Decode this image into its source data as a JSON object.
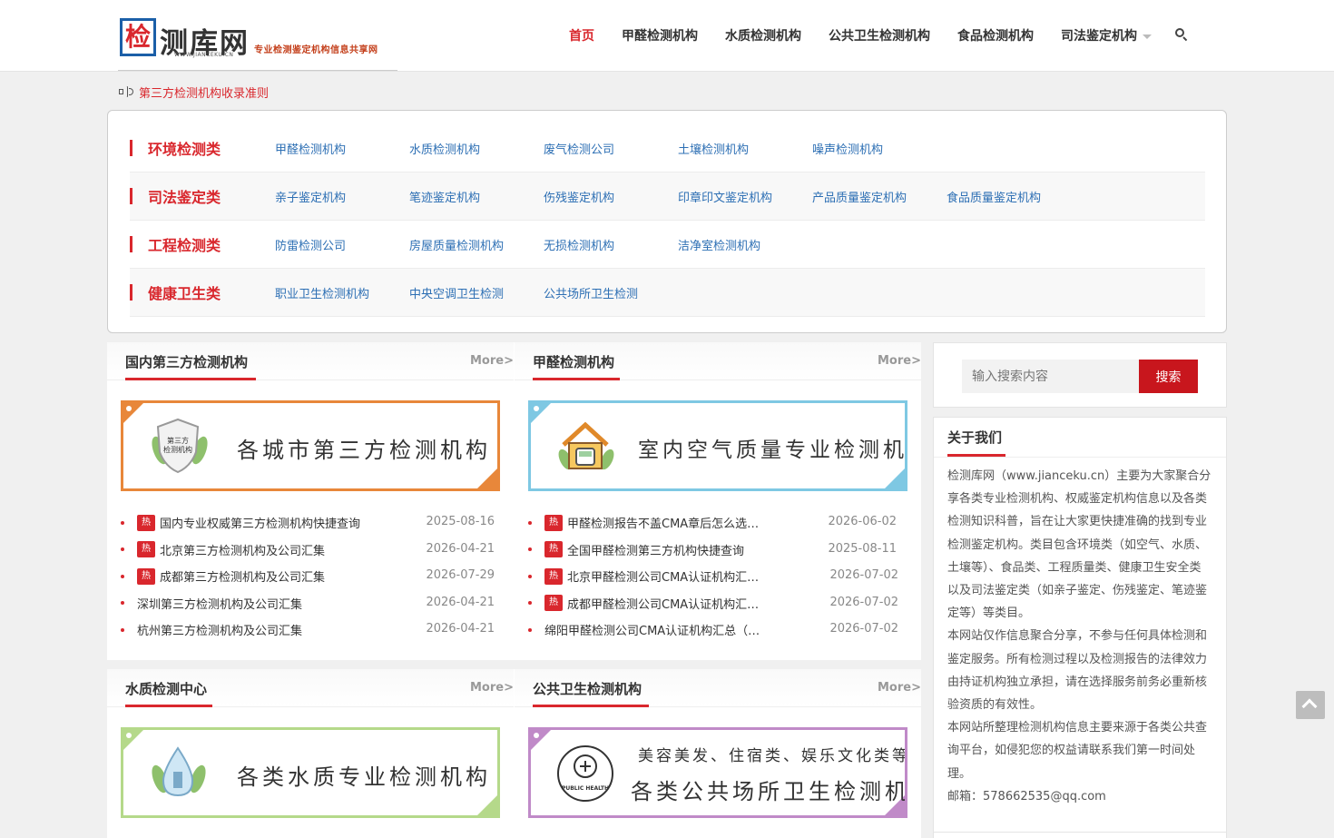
{
  "header": {
    "logo_char": "检",
    "logo_text": "测库网",
    "logo_url": "WWW.JIANCEKU.CN",
    "logo_slogan": "专业检测鉴定机构信息共享网",
    "nav": [
      {
        "label": "首页"
      },
      {
        "label": "甲醛检测机构"
      },
      {
        "label": "水质检测机构"
      },
      {
        "label": "公共卫生检测机构"
      },
      {
        "label": "食品检测机构"
      },
      {
        "label": "司法鉴定机构"
      }
    ]
  },
  "notice": {
    "text": "第三方检测机构收录准则"
  },
  "categories": [
    {
      "title": "环境检测类",
      "links": [
        "甲醛检测机构",
        "水质检测机构",
        "废气检测公司",
        "土壤检测机构",
        "噪声检测机构"
      ]
    },
    {
      "title": "司法鉴定类",
      "links": [
        "亲子鉴定机构",
        "笔迹鉴定机构",
        "伤残鉴定机构",
        "印章印文鉴定机构",
        "产品质量鉴定机构",
        "食品质量鉴定机构"
      ]
    },
    {
      "title": "工程检测类",
      "links": [
        "防雷检测公司",
        "房屋质量检测机构",
        "无损检测机构",
        "洁净室检测机构"
      ]
    },
    {
      "title": "健康卫生类",
      "links": [
        "职业卫生检测机构",
        "中央空调卫生检测",
        "公共场所卫生检测"
      ]
    }
  ],
  "panels": [
    {
      "title": "国内第三方检测机构",
      "more": "More>",
      "banner_text": "各城市第三方检测机构",
      "banner_icon_text": "第三方\n检测机构",
      "accent": "#e8873a",
      "items": [
        {
          "hot": true,
          "title": "国内专业权威第三方检测机构快捷查询",
          "date": "2025-08-16"
        },
        {
          "hot": true,
          "title": "北京第三方检测机构及公司汇集",
          "date": "2026-04-21"
        },
        {
          "hot": true,
          "title": "成都第三方检测机构及公司汇集",
          "date": "2026-07-29"
        },
        {
          "hot": false,
          "title": "深圳第三方检测机构及公司汇集",
          "date": "2026-04-21"
        },
        {
          "hot": false,
          "title": "杭州第三方检测机构及公司汇集",
          "date": "2026-04-21"
        }
      ]
    },
    {
      "title": "甲醛检测机构",
      "more": "More>",
      "banner_text": "室内空气质量专业检测机构",
      "accent": "#7ec8e3",
      "items": [
        {
          "hot": true,
          "title": "甲醛检测报告不盖CMA章后怎么选…",
          "date": "2026-06-02"
        },
        {
          "hot": true,
          "title": "全国甲醛检测第三方机构快捷查询",
          "date": "2025-08-11"
        },
        {
          "hot": true,
          "title": "北京甲醛检测公司CMA认证机构汇…",
          "date": "2026-07-02"
        },
        {
          "hot": true,
          "title": "成都甲醛检测公司CMA认证机构汇…",
          "date": "2026-07-02"
        },
        {
          "hot": false,
          "title": "绵阳甲醛检测公司CMA认证机构汇总（…",
          "date": "2026-07-02"
        }
      ]
    },
    {
      "title": "水质检测中心",
      "more": "More>",
      "banner_text": "各类水质专业检测机构",
      "accent": "#b5d98a"
    },
    {
      "title": "公共卫生检测机构",
      "more": "More>",
      "banner_sub": "美容美发、住宿类、娱乐文化类等",
      "banner_text": "各类公共场所卫生检测机构",
      "banner_icon_text": "PUBLIC HEALTH",
      "accent": "#c08ac8"
    }
  ],
  "hot_label": "热",
  "sidebar": {
    "search_placeholder": "输入搜索内容",
    "search_button": "搜索",
    "about_title": "关于我们",
    "about_p1": "检测库网（www.jianceku.cn）主要为大家聚合分享各类专业检测机构、权威鉴定机构信息以及各类检测知识科普，旨在让大家更快捷准确的找到专业检测鉴定机构。类目包含环境类（如空气、水质、土壤等）、食品类、工程质量类、健康卫生安全类以及司法鉴定类（如亲子鉴定、伤残鉴定、笔迹鉴定等）等类目。",
    "about_p2": "本网站仅作信息聚合分享，不参与任何具体检测和鉴定服务。所有检测过程以及检测报告的法律效力由持证机构独立承担，请在选择服务前务必重新核验资质的有效性。",
    "about_p3": "本网站所整理检测机构信息主要来源于各类公共查询平台，如侵犯您的权益请联系我们第一时间处理。",
    "about_email": "邮箱：578662535@qq.com"
  }
}
